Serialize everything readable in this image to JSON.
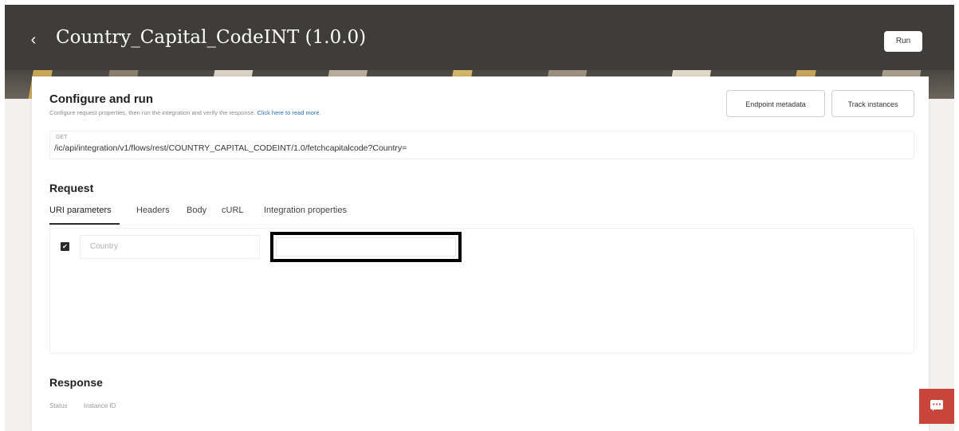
{
  "header": {
    "back_label": "‹",
    "title": "Country_Capital_CodeINT (1.0.0)",
    "run_label": "Run"
  },
  "configure": {
    "title": "Configure and run",
    "subtitle": "Configure request properties, then run the integration and verify the response.",
    "read_more_link": "Click here to read more.",
    "endpoint_metadata_label": "Endpoint metadata",
    "track_instances_label": "Track instances"
  },
  "endpoint": {
    "method": "GET",
    "path": "/ic/api/integration/v1/flows/rest/COUNTRY_CAPITAL_CODEINT/1.0/fetchcapitalcode?Country="
  },
  "request": {
    "title": "Request",
    "tabs": [
      {
        "label": "URI parameters",
        "active": true
      },
      {
        "label": "Headers",
        "active": false
      },
      {
        "label": "Body",
        "active": false
      },
      {
        "label": "cURL",
        "active": false
      },
      {
        "label": "Integration properties",
        "active": false
      }
    ],
    "params": [
      {
        "checked": true,
        "name": "Country",
        "value": ""
      }
    ]
  },
  "response": {
    "title": "Response",
    "columns": [
      "Status",
      "Instance ID"
    ]
  },
  "icons": {
    "back": "chevron-left-icon",
    "checkbox": "checkbox-checked-icon",
    "chat": "chat-icon"
  },
  "colors": {
    "header_bg": "#3f3d3a",
    "chat_button": "#c7453a",
    "link": "#2a6fb3"
  }
}
